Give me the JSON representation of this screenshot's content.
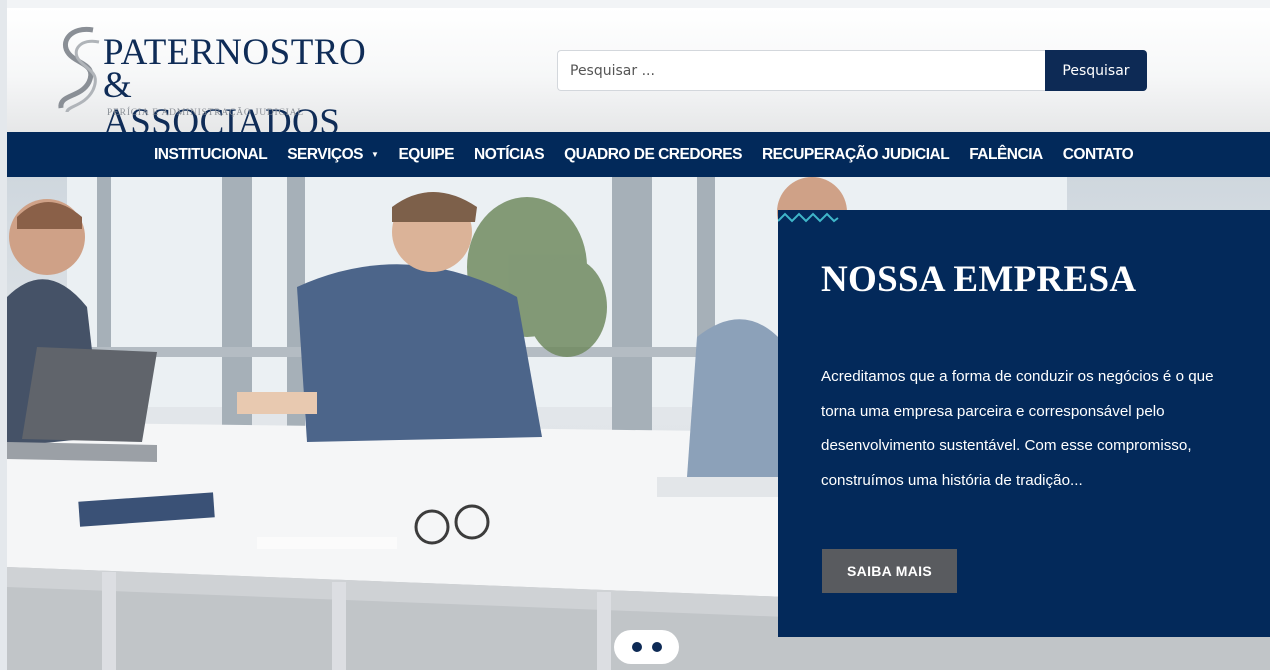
{
  "header": {
    "logo": {
      "line1": "PATERNOSTRO",
      "line2": "& ASSOCIADOS",
      "tagline": "PERÍCIA E ADMINISTRAÇÃO JUDICIAL"
    },
    "search": {
      "placeholder": "Pesquisar ...",
      "button_label": "Pesquisar"
    }
  },
  "nav": {
    "items": [
      {
        "label": "INSTITUCIONAL"
      },
      {
        "label": "SERVIÇOS",
        "has_dropdown": true
      },
      {
        "label": "EQUIPE"
      },
      {
        "label": "NOTÍCIAS"
      },
      {
        "label": "QUADRO DE CREDORES"
      },
      {
        "label": "RECUPERAÇÃO JUDICIAL"
      },
      {
        "label": "FALÊNCIA"
      },
      {
        "label": "CONTATO"
      }
    ],
    "dropdown_glyph": "▼"
  },
  "hero": {
    "title": "NOSSA EMPRESA",
    "text": "Acreditamos que a forma de conduzir os negócios é o que torna uma empresa parceira e corresponsável pelo desenvolvimento sustentável. Com esse compromisso, construímos uma história de tradição...",
    "button_label": "SAIBA MAIS",
    "slides": 2,
    "active_slide": 1
  },
  "colors": {
    "brand_navy": "#02295a",
    "button_gray": "#595b5f",
    "wave_accent": "#3fb6c9"
  }
}
